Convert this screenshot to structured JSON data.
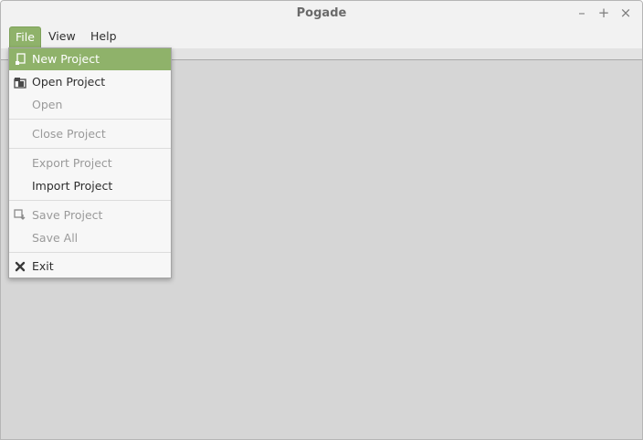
{
  "window": {
    "title": "Pogade",
    "controls": {
      "minimize": "–",
      "maximize": "+",
      "close": "×"
    }
  },
  "menubar": {
    "items": [
      {
        "label": "File",
        "active": true
      },
      {
        "label": "View"
      },
      {
        "label": "Help"
      }
    ]
  },
  "file_menu": {
    "items": [
      {
        "label": "New Project",
        "icon": "new-project-icon",
        "state": "highlighted"
      },
      {
        "label": "Open Project",
        "icon": "open-project-icon",
        "state": "enabled"
      },
      {
        "label": "Open",
        "state": "disabled"
      },
      {
        "label": "Close Project",
        "state": "disabled"
      },
      {
        "label": "Export Project",
        "state": "disabled"
      },
      {
        "label": "Import Project",
        "state": "enabled"
      },
      {
        "label": "Save Project",
        "icon": "save-project-icon",
        "state": "disabled"
      },
      {
        "label": "Save All",
        "state": "disabled"
      },
      {
        "label": "Exit",
        "icon": "exit-icon",
        "state": "enabled"
      }
    ]
  },
  "colors": {
    "accent": "#8fb26a",
    "menu_bg": "#f7f7f7",
    "workspace_bg": "#d6d6d6"
  }
}
